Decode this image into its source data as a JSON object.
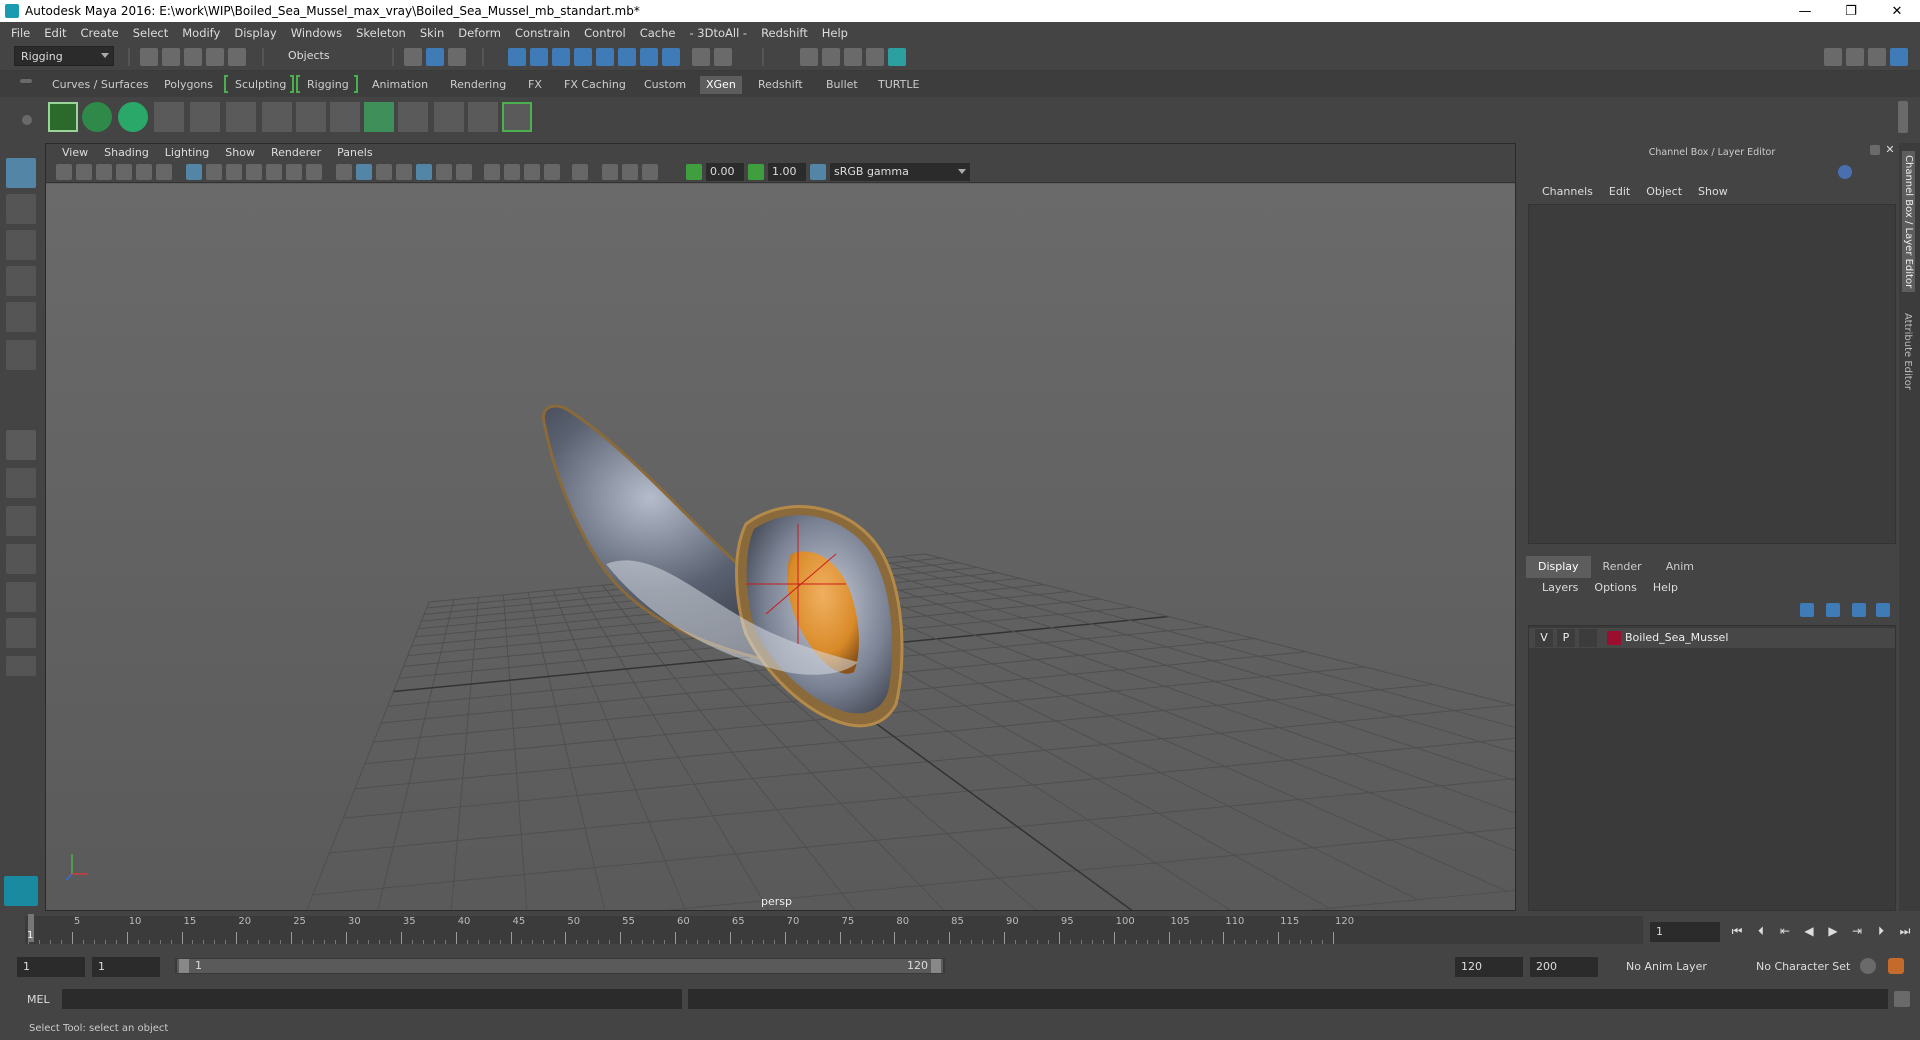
{
  "window": {
    "title": "Autodesk Maya 2016: E:\\work\\WIP\\Boiled_Sea_Mussel_max_vray\\Boiled_Sea_Mussel_mb_standart.mb*",
    "minimize": "—",
    "restore": "❐",
    "close": "✕"
  },
  "menubar": [
    "File",
    "Edit",
    "Create",
    "Select",
    "Modify",
    "Display",
    "Windows",
    "Skeleton",
    "Skin",
    "Deform",
    "Constrain",
    "Control",
    "Cache",
    "- 3DtoAll -",
    "Redshift",
    "Help"
  ],
  "statusline": {
    "menuset": "Rigging",
    "selection_mode": "Objects"
  },
  "shelf": {
    "tabs": [
      "Curves / Surfaces",
      "Polygons",
      "Sculpting",
      "Rigging",
      "Animation",
      "Rendering",
      "FX",
      "FX Caching",
      "Custom",
      "XGen",
      "Redshift",
      "Bullet",
      "TURTLE"
    ],
    "active_tab": "XGen"
  },
  "viewport": {
    "menu": [
      "View",
      "Shading",
      "Lighting",
      "Show",
      "Renderer",
      "Panels"
    ],
    "near_value": "0.00",
    "far_value": "1.00",
    "color_space": "sRGB gamma",
    "camera_label": "persp"
  },
  "rightpanel": {
    "header": "Channel Box / Layer Editor",
    "channel_menu": [
      "Channels",
      "Edit",
      "Object",
      "Show"
    ],
    "layer_tabs": [
      "Display",
      "Render",
      "Anim"
    ],
    "active_layer_tab": "Display",
    "layer_menu": [
      "Layers",
      "Options",
      "Help"
    ],
    "layers": [
      {
        "visible": "V",
        "playback": "P",
        "name": "Boiled_Sea_Mussel",
        "color": "#9b0e2e"
      }
    ]
  },
  "sidetabs": [
    "Channel Box / Layer Editor",
    "Attribute Editor"
  ],
  "timeslider": {
    "ticks": [
      "5",
      "10",
      "15",
      "20",
      "25",
      "30",
      "35",
      "40",
      "45",
      "50",
      "55",
      "60",
      "65",
      "70",
      "75",
      "80",
      "85",
      "90",
      "95",
      "100",
      "105",
      "110",
      "115",
      "120"
    ],
    "current_frame": "1",
    "frame_field": "1"
  },
  "range": {
    "start": "1",
    "playback_start": "1",
    "slider_start": "1",
    "slider_end": "120",
    "playback_end": "120",
    "end": "200",
    "anim_layer": "No Anim Layer",
    "character_set": "No Character Set"
  },
  "cmdline": {
    "label": "MEL",
    "help": "Select Tool: select an object"
  }
}
